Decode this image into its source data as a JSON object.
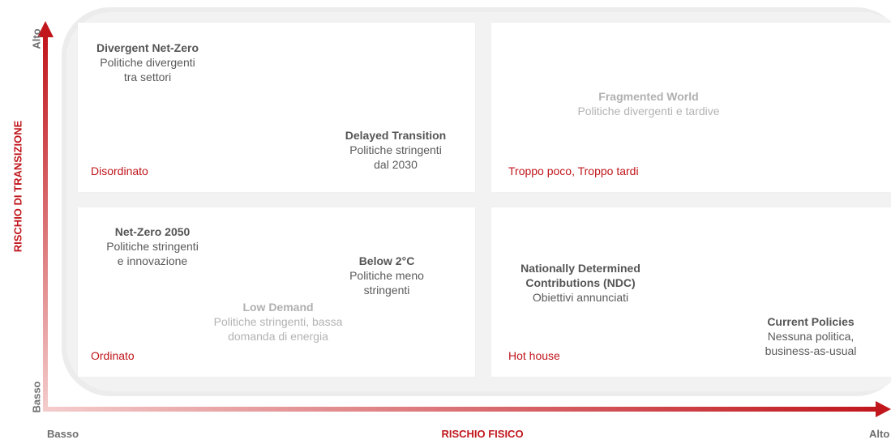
{
  "axes": {
    "y_label": "RISCHIO DI TRANSIZIONE",
    "y_high": "Alto",
    "y_low": "Basso",
    "x_label": "RISCHIO FISICO",
    "x_low": "Basso",
    "x_high": "Alto",
    "accent_color": "#c0161c"
  },
  "quadrants": {
    "top_left": {
      "label": "Disordinato"
    },
    "top_right": {
      "label": "Troppo poco, Troppo tardi"
    },
    "bottom_left": {
      "label": "Ordinato"
    },
    "bottom_right": {
      "label": "Hot house"
    }
  },
  "scenarios": {
    "divergent": {
      "title": "Divergent Net-Zero",
      "line1": "Politiche divergenti",
      "line2": "tra settori"
    },
    "delayed": {
      "title": "Delayed Transition",
      "line1": "Politiche stringenti",
      "line2": "dal 2030"
    },
    "fragmented": {
      "title": "Fragmented World",
      "line1": "Politiche divergenti e tardive"
    },
    "netzero": {
      "title": "Net-Zero 2050",
      "line1": "Politiche stringenti",
      "line2": "e innovazione"
    },
    "below2": {
      "title": "Below 2°C",
      "line1": "Politiche meno",
      "line2": "stringenti"
    },
    "lowdemand": {
      "title": "Low Demand",
      "line1": "Politiche stringenti, bassa",
      "line2": "domanda di energia"
    },
    "ndc": {
      "title": "Nationally Determined",
      "title2": "Contributions (NDC)",
      "line1": "Obiettivi annunciati"
    },
    "current": {
      "title": "Current Policies",
      "line1": "Nessuna politica,",
      "line2": "business-as-usual"
    }
  }
}
